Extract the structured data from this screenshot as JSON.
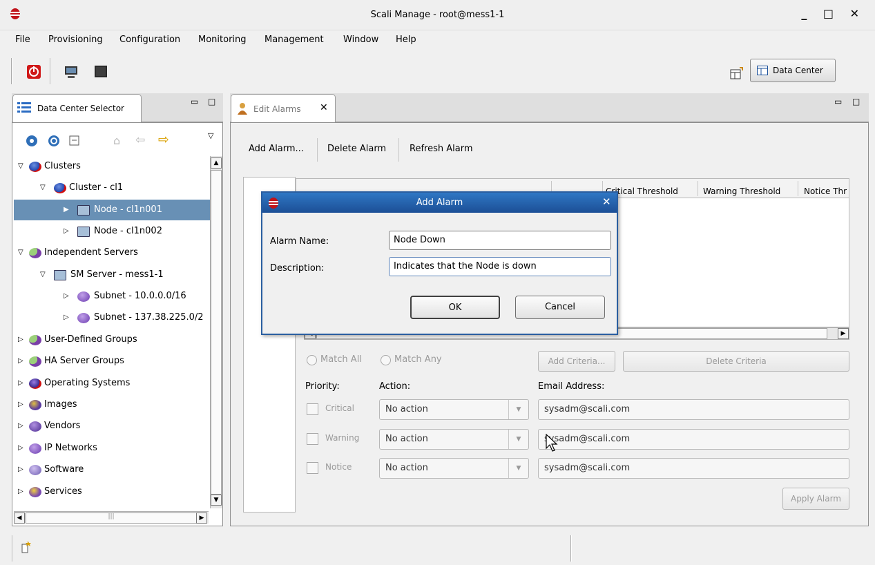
{
  "window": {
    "title": "Scali Manage - root@mess1-1",
    "controls": "_ □ ✕"
  },
  "menu": [
    "File",
    "Provisioning",
    "Configuration",
    "Monitoring",
    "Management",
    "Window",
    "Help"
  ],
  "toolbar": {
    "data_center_label": "Data Center"
  },
  "left_panel": {
    "tab_label": "Data Center Selector",
    "tree": [
      {
        "label": "Clusters",
        "icon": "globe-red-icon",
        "expanded": true
      },
      {
        "label": "Cluster - cl1",
        "icon": "globe-red-icon",
        "expanded": true
      },
      {
        "label": "Node - cl1n001",
        "icon": "computer-icon",
        "expanded": false,
        "selected": true
      },
      {
        "label": "Node - cl1n002",
        "icon": "computer-icon",
        "expanded": false
      },
      {
        "label": "Independent Servers",
        "icon": "server-group-icon",
        "expanded": true
      },
      {
        "label": "SM Server - mess1-1",
        "icon": "computer-icon",
        "expanded": true
      },
      {
        "label": "Subnet - 10.0.0.0/16",
        "icon": "subnet-icon",
        "expanded": false
      },
      {
        "label": "Subnet - 137.38.225.0/2",
        "icon": "subnet-icon",
        "expanded": false
      },
      {
        "label": "User-Defined Groups",
        "icon": "server-group-icon",
        "expanded": false
      },
      {
        "label": "HA Server Groups",
        "icon": "server-group-icon",
        "expanded": false
      },
      {
        "label": "Operating Systems",
        "icon": "os-icon",
        "expanded": false
      },
      {
        "label": "Images",
        "icon": "images-icon",
        "expanded": false
      },
      {
        "label": "Vendors",
        "icon": "vendors-icon",
        "expanded": false
      },
      {
        "label": "IP Networks",
        "icon": "network-icon",
        "expanded": false
      },
      {
        "label": "Software",
        "icon": "software-icon",
        "expanded": false
      },
      {
        "label": "Services",
        "icon": "services-icon",
        "expanded": false
      }
    ]
  },
  "editor": {
    "tab_label": "Edit Alarms",
    "actions": {
      "add": "Add Alarm...",
      "delete": "Delete Alarm",
      "refresh": "Refresh Alarm"
    },
    "columns": {
      "critical": "Critical Threshold",
      "warning": "Warning Threshold",
      "notice": "Notice Thr"
    },
    "match_all": "Match All",
    "match_any": "Match Any",
    "add_criteria": "Add Criteria...",
    "delete_criteria": "Delete Criteria",
    "priority_label": "Priority:",
    "action_label": "Action:",
    "email_label": "Email Address:",
    "rows": [
      {
        "priority": "Critical",
        "action": "No action",
        "email": "sysadm@scali.com"
      },
      {
        "priority": "Warning",
        "action": "No action",
        "email": "sysadm@scali.com"
      },
      {
        "priority": "Notice",
        "action": "No action",
        "email": "sysadm@scali.com"
      }
    ],
    "apply": "Apply Alarm"
  },
  "dialog": {
    "title": "Add Alarm",
    "name_label": "Alarm Name:",
    "name_value": "Node Down",
    "desc_label": "Description:",
    "desc_value": "Indicates that the Node is down",
    "ok": "OK",
    "cancel": "Cancel"
  },
  "colors": {
    "selection": "#6890b5",
    "dialog_title": "#2563b0"
  }
}
